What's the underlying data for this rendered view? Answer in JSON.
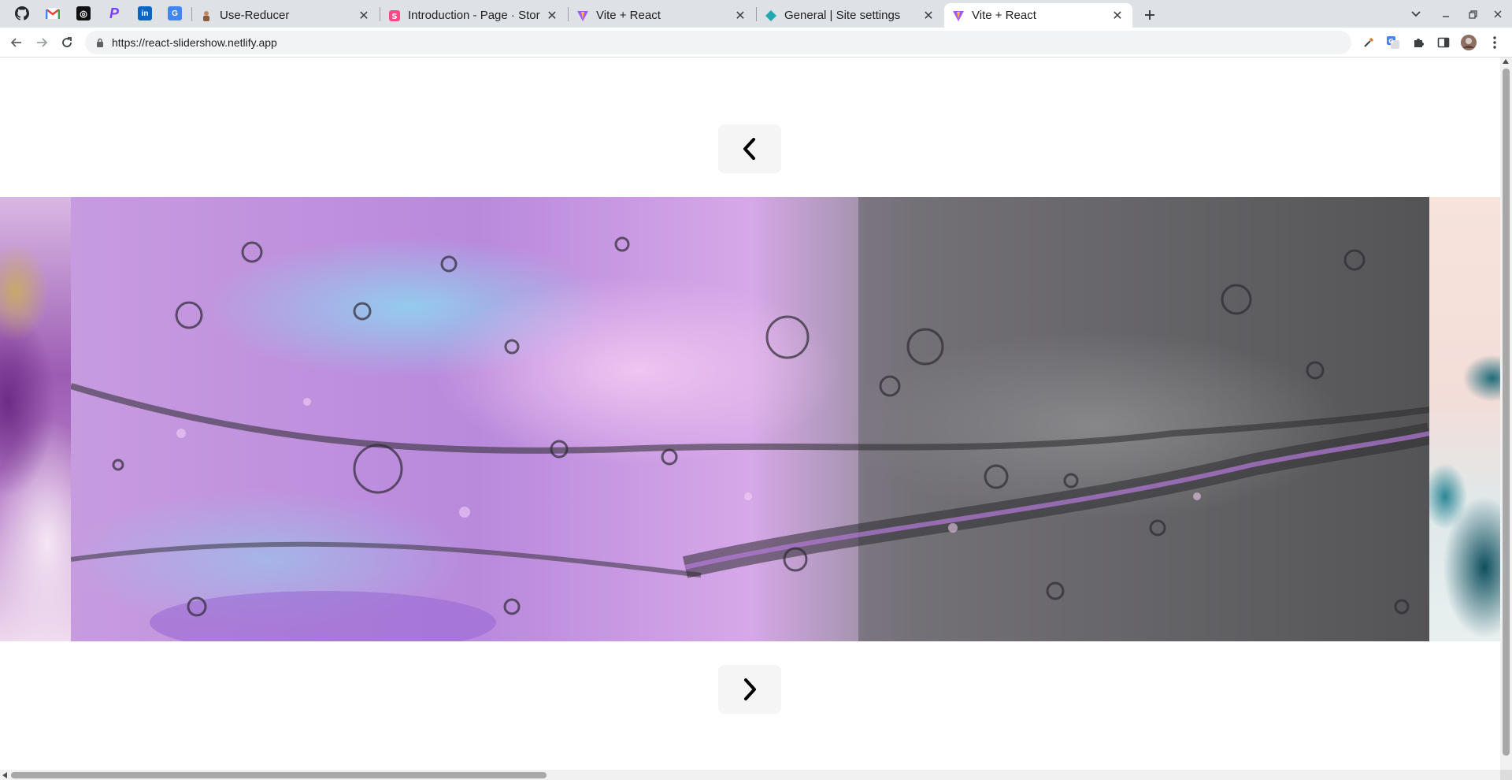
{
  "browser": {
    "pinned_tabs": [
      {
        "icon": "github-icon",
        "color": "#24292f"
      },
      {
        "icon": "gmail-icon",
        "color": "#ea4335"
      },
      {
        "icon": "chatgpt-icon",
        "color": "#111111"
      },
      {
        "icon": "paypal-icon",
        "color": "#7a3cff"
      },
      {
        "icon": "linkedin-icon",
        "color": "#0a66c2"
      },
      {
        "icon": "google-translate-icon",
        "color": "#4285f4"
      }
    ],
    "tabs": [
      {
        "title": "Use-Reducer",
        "icon": "frontend-mentor-icon",
        "active": false
      },
      {
        "title": "Introduction - Page · Storybook",
        "icon": "storybook-icon",
        "active": false
      },
      {
        "title": "Vite + React",
        "icon": "vite-icon",
        "active": false
      },
      {
        "title": "General | Site settings",
        "icon": "netlify-icon",
        "active": false
      },
      {
        "title": "Vite + React",
        "icon": "vite-icon",
        "active": true
      }
    ],
    "url": "https://react-slidershow.netlify.app"
  },
  "page": {
    "prev_button_icon": "chevron-left-icon",
    "next_button_icon": "chevron-right-icon",
    "slides": [
      {
        "position": "previous",
        "description": "purple fluid art"
      },
      {
        "position": "current",
        "description": "purple and grey water splash"
      },
      {
        "position": "next",
        "description": "teal fluid art"
      }
    ]
  },
  "colors": {
    "tabstrip": "#dee1e6",
    "active_tab": "#ffffff",
    "omnibox": "#f1f3f4",
    "arrow_button_bg": "#f5f5f5"
  }
}
